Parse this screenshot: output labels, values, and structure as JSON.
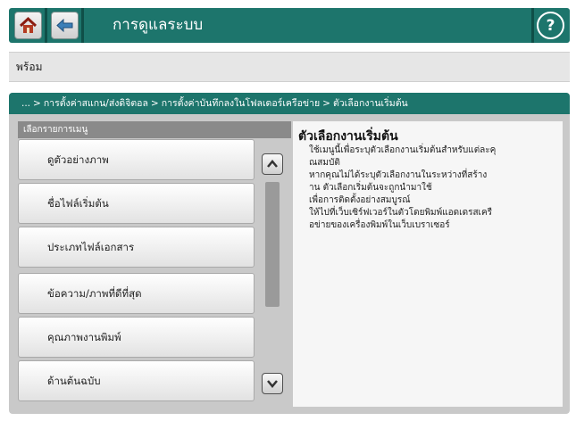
{
  "header": {
    "title": "การดูแลระบบ",
    "home_icon": "home-icon",
    "back_icon": "back-icon",
    "help_icon": "help-icon",
    "accent": "#1d756c"
  },
  "status": {
    "text": "พร้อม"
  },
  "breadcrumb": {
    "items": [
      "...",
      "การตั้งค่าสแกน/ส่งดิจิตอล",
      "การตั้งค่าบันทึกลงในโฟลเดอร์เครือข่าย",
      "ตัวเลือกงานเริ่มต้น"
    ]
  },
  "menu": {
    "header": "เลือกรายการเมนู",
    "items": [
      {
        "label": "ดูตัวอย่างภาพ"
      },
      {
        "label": "ชื่อไฟล์เริ่มต้น"
      },
      {
        "label": "ประเภทไฟล์เอกสาร"
      },
      {
        "label": "ข้อความ/ภาพที่ดีที่สุด"
      },
      {
        "label": "คุณภาพงานพิมพ์"
      },
      {
        "label": "ด้านต้นฉบับ"
      }
    ]
  },
  "description": {
    "title": "ตัวเลือกงานเริ่มต้น",
    "lines": [
      "ใช้เมนูนี้เพื่อระบุตัวเลือกงานเริ่มต้นสำหรับแต่ละคุ",
      "ณสมบัติ",
      "หากคุณไม่ได้ระบุตัวเลือกงานในระหว่างที่สร้าง",
      "าน ตัวเลือกเริ่มต้นจะถูกนำมาใช้",
      "เพื่อการติดตั้งอย่างสมบูรณ์",
      "ให้ไปที่เว็บเซิร์ฟเวอร์ในตัวโดยพิมพ์แอดเดรสเครื",
      "อข่ายของเครื่องพิมพ์ในเว็บเบราเซอร์"
    ]
  }
}
